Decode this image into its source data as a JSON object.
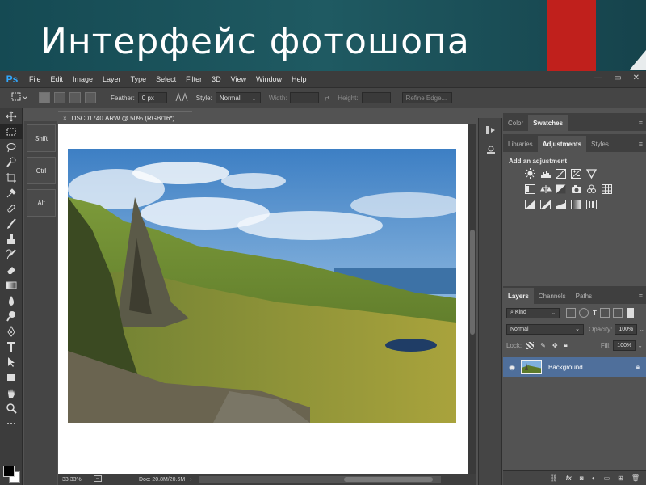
{
  "slide": {
    "title": "Интерфейс фотошопа"
  },
  "app": {
    "logo": "Ps",
    "menu": [
      "File",
      "Edit",
      "Image",
      "Layer",
      "Type",
      "Select",
      "Filter",
      "3D",
      "View",
      "Window",
      "Help"
    ],
    "window_controls": [
      "—",
      "▭",
      "✕"
    ]
  },
  "options_bar": {
    "feather_label": "Feather:",
    "feather_value": "0 px",
    "style_label": "Style:",
    "style_value": "Normal",
    "width_label": "Width:",
    "height_label": "Height:",
    "refine_edge": "Refine Edge..."
  },
  "tools": [
    "move",
    "marquee",
    "lasso",
    "quick-selection",
    "crop",
    "eyedropper",
    "healing-brush",
    "brush",
    "clone-stamp",
    "history-brush",
    "eraser",
    "gradient",
    "blur",
    "dodge",
    "pen",
    "type",
    "path-selection",
    "rectangle",
    "hand",
    "zoom",
    "more"
  ],
  "modifier_keys": [
    "Shift",
    "Ctrl",
    "Alt"
  ],
  "document": {
    "tab_title": "DSC01740.ARW @ 50% (RGB/16*)",
    "close": "×",
    "zoom": "33.33%",
    "doc_size": "Doc: 20.8M/20.6M"
  },
  "panels": {
    "top_tabs": [
      "Color",
      "Swatches"
    ],
    "mid_tabs": [
      "Libraries",
      "Adjustments",
      "Styles"
    ],
    "adjustments_title": "Add an adjustment",
    "layers_tabs": [
      "Layers",
      "Channels",
      "Paths"
    ],
    "kind_label": "Kind",
    "blend_mode": "Normal",
    "opacity_label": "Opacity:",
    "opacity_value": "100%",
    "lock_label": "Lock:",
    "fill_label": "Fill:",
    "fill_value": "100%",
    "layer_name": "Background",
    "bottom_icons": [
      "link-icon",
      "fx-icon",
      "mask-icon",
      "adjustment-icon",
      "folder-icon",
      "new-layer-icon",
      "trash-icon"
    ],
    "fx_label": "fx"
  },
  "colors": {
    "slide_bg": "#1b4c55",
    "accent_red": "#c0201c",
    "ps_blue": "#31a8ff",
    "selected_layer": "#4f6f9b"
  }
}
